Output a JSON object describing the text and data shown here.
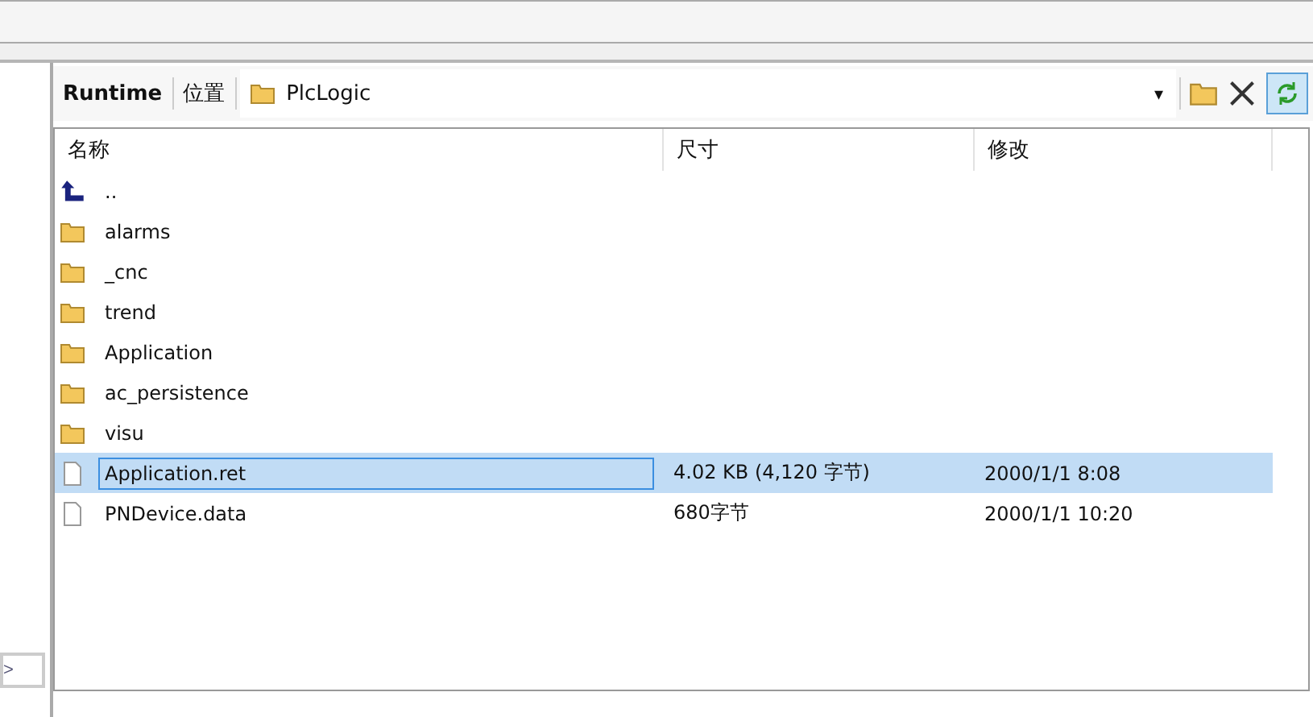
{
  "toolbar": {
    "runtime_label": "Runtime",
    "location_label": "位置",
    "path": "PlcLogic",
    "dropdown": "▾",
    "refresh_active": true
  },
  "table": {
    "columns": [
      "名称",
      "尺寸",
      "修改"
    ],
    "rows": [
      {
        "kind": "up",
        "name": "..",
        "size": "",
        "modified": "",
        "selected": false
      },
      {
        "kind": "folder",
        "name": "alarms",
        "selected": false
      },
      {
        "kind": "folder",
        "name": "_cnc",
        "selected": false
      },
      {
        "kind": "folder",
        "name": "trend",
        "selected": false
      },
      {
        "kind": "folder",
        "name": "Application",
        "selected": false
      },
      {
        "kind": "folder",
        "name": "ac_persistence",
        "selected": false
      },
      {
        "kind": "folder",
        "name": "visu",
        "selected": false
      },
      {
        "kind": "file",
        "name": "Application.ret",
        "size": "4.02 KB (4,120 字节)",
        "modified": "2000/1/1 8:08",
        "selected": true
      },
      {
        "kind": "file",
        "name": "PNDevice.data",
        "size": "680字节",
        "modified": "2000/1/1 10:20",
        "selected": false
      }
    ]
  },
  "side_button": ">"
}
